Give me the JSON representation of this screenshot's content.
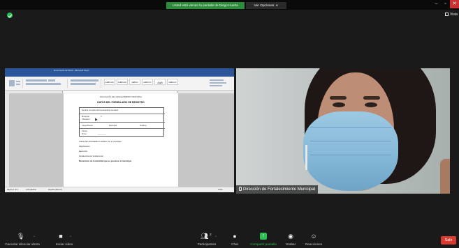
{
  "top_bar": {
    "sharing_banner": "Usted está viendo la pantalla de Diego Huerta",
    "view_options_label": "Ver Opciones",
    "view_mode_label": "Vista"
  },
  "shared_screen": {
    "window_title": "Documento de Word - Microsoft Word",
    "ribbon_tabs": [
      "Archivo",
      "Inicio",
      "Insertar",
      "Diseño",
      "Disposición",
      "Referencias",
      "Correspondencia",
      "Revisar",
      "Vista",
      "Ayuda"
    ],
    "style_gallery": [
      "AaBbCcDc",
      "AaBbCcDc",
      "AaBbCc",
      "AaBbCcC",
      "AaB",
      "AaBbCcC"
    ],
    "document": {
      "header": "ASOCIACIÓN DE FORTALECIMIENTO MUNICIPAL",
      "title": "DATOS DEL FORMULARIO DE REGISTRO",
      "form_intro": "Nombre completo del funcionario/a municipal",
      "field_1_label": "Municipio",
      "field_1b_label": "Ubicación",
      "field_2_label": "Cargo/Puesto",
      "field_2_value": "Municipal",
      "field_3_label": "Teléfono",
      "field_4_label": "Correo",
      "field_5_label": "Firma",
      "question": "Indicar las actividades a realizar con el municipio:",
      "item_1": "Planificación",
      "item_2": "Ejecución",
      "item_3": "Fortalecimiento institucional",
      "footer_note": "Mecanismo de la actividad que se presta en el municipio"
    },
    "status_left": "Página 1 de 1",
    "status_words": "126 palabras",
    "status_lang": "Español (México)",
    "status_zoom": "100%"
  },
  "video": {
    "participant_name": "Dirección de Fortalecimiento Municipal"
  },
  "toolbar": {
    "unmute_label": "Cancelar silenciar ahora",
    "start_video_label": "Iniciar video",
    "participants_label": "Participantes",
    "participants_count": "2",
    "chat_label": "Chat",
    "share_screen_label": "Compartir pantalla",
    "record_label": "Grabar",
    "reactions_label": "Reacciones",
    "end_label": "Salir"
  },
  "colors": {
    "banner_green": "#2d8c3c",
    "share_green": "#2fbd55",
    "end_red": "#d83b30",
    "word_blue": "#2b579a"
  }
}
